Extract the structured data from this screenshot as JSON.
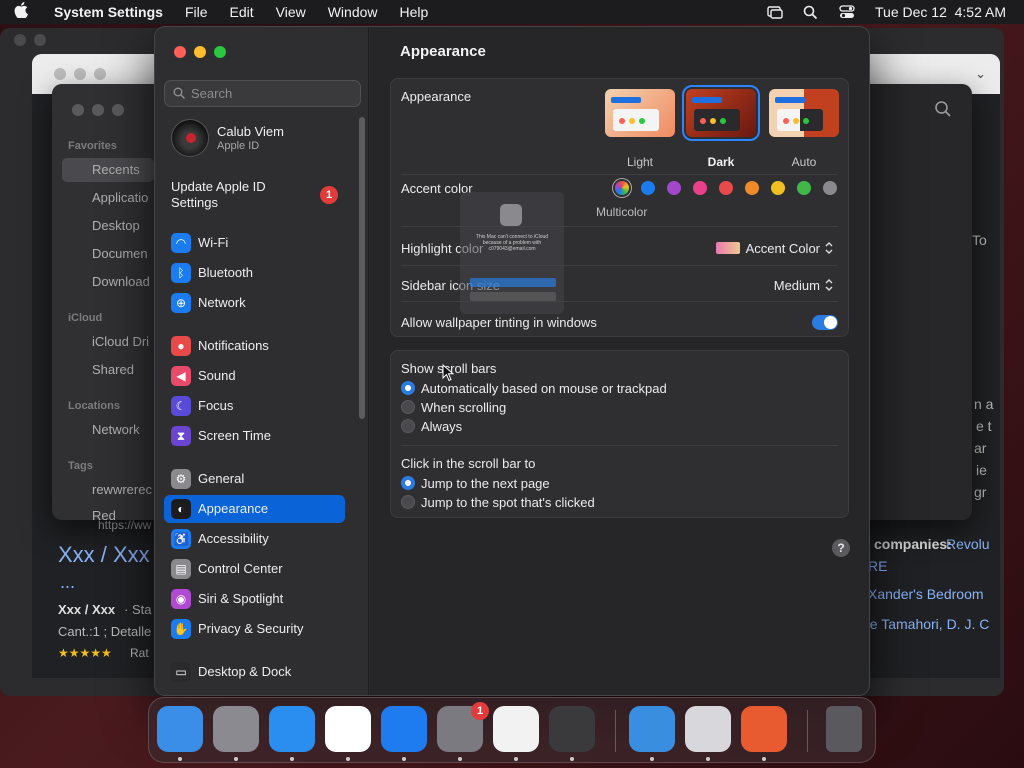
{
  "menubar": {
    "app_name": "System Settings",
    "menus": [
      "File",
      "Edit",
      "View",
      "Window",
      "Help"
    ],
    "datetime": "Tue Dec 12  4:52 AM"
  },
  "finder": {
    "favorites_label": "Favorites",
    "favorites": [
      "Recents",
      "Applicatio",
      "Desktop",
      "Documen",
      "Download"
    ],
    "icloud_label": "iCloud",
    "icloud": [
      "iCloud Dri",
      "Shared"
    ],
    "locations_label": "Locations",
    "locations": [
      "Network"
    ],
    "tags_label": "Tags",
    "tags": [
      "rewwrerec",
      "Red"
    ]
  },
  "browser": {
    "url_fragment": "https://ww",
    "result_title": "Xxx / Xxx",
    "ellipsis": "...",
    "snippet_bold": "Xxx / Xxx",
    "snippet_rest": " · Sta",
    "snippet_line2": "Cant.:1 ; Detalle",
    "rating_text": "Rat",
    "right_texts": [
      "To",
      "n a",
      "e t",
      "ar",
      "ie",
      "gr"
    ],
    "companies_label": "companies:",
    "companies_value": "Revolu",
    "companies_more": "RE",
    "xander": "Xander's Bedroom",
    "tamahori": "ee Tamahori, D. J. C"
  },
  "sidebar": {
    "search_placeholder": "Search",
    "user_name": "Calub Viem",
    "user_sub": "Apple ID",
    "update_label": "Update Apple ID Settings",
    "update_badge": "1",
    "items": [
      {
        "label": "Wi-Fi",
        "color": "#1a7cf0",
        "glyph": "◠"
      },
      {
        "label": "Bluetooth",
        "color": "#1a7cf0",
        "glyph": "ᛒ"
      },
      {
        "label": "Network",
        "color": "#1a7cf0",
        "glyph": "⊕"
      },
      {
        "label": "Notifications",
        "color": "#e84a4a",
        "glyph": "●"
      },
      {
        "label": "Sound",
        "color": "#e84a6a",
        "glyph": "◀"
      },
      {
        "label": "Focus",
        "color": "#5a4ad8",
        "glyph": "☾"
      },
      {
        "label": "Screen Time",
        "color": "#6a46d0",
        "glyph": "⧗"
      },
      {
        "label": "General",
        "color": "#8a8a8e",
        "glyph": "⚙"
      },
      {
        "label": "Appearance",
        "color": "#1c1c1e",
        "glyph": "◐"
      },
      {
        "label": "Accessibility",
        "color": "#1a7cf0",
        "glyph": "♿"
      },
      {
        "label": "Control Center",
        "color": "#8a8a8e",
        "glyph": "▤"
      },
      {
        "label": "Siri & Spotlight",
        "color": "#b04ad0",
        "glyph": "◉"
      },
      {
        "label": "Privacy & Security",
        "color": "#1a7cf0",
        "glyph": "✋"
      },
      {
        "label": "Desktop & Dock",
        "color": "#2a2a2c",
        "glyph": "▭"
      }
    ]
  },
  "main": {
    "title": "Appearance",
    "appearance_label": "Appearance",
    "modes": [
      "Light",
      "Dark",
      "Auto"
    ],
    "selected_mode": "Dark",
    "accent_label": "Accent color",
    "accent_colors": [
      "multicolor",
      "#1a7cf0",
      "#a048c8",
      "#e8408a",
      "#e84a4a",
      "#f08a28",
      "#f0c020",
      "#40b848",
      "#8a8a8e"
    ],
    "accent_selected_name": "Multicolor",
    "highlight_label": "Highlight color",
    "highlight_value": "Accent Color",
    "sidebar_icon_label": "Sidebar icon size",
    "sidebar_icon_value": "Medium",
    "tinting_label": "Allow wallpaper tinting in windows",
    "tinting_on": true,
    "scroll_label": "Show scroll bars",
    "scroll_options": [
      "Automatically based on mouse or trackpad",
      "When scrolling",
      "Always"
    ],
    "click_label": "Click in the scroll bar to",
    "click_options": [
      "Jump to the next page",
      "Jump to the spot that's clicked"
    ],
    "help": "?",
    "ghost_text": "This Mac can't connect to iCloud because of a problem with c079043@email.com"
  },
  "dock": {
    "apps": [
      {
        "name": "finder",
        "color": "#3a8ee8"
      },
      {
        "name": "launchpad",
        "color": "#8a8a90"
      },
      {
        "name": "safari",
        "color": "#2a8ef0"
      },
      {
        "name": "chrome",
        "color": "#ffffff"
      },
      {
        "name": "app-store",
        "color": "#1e7cf0"
      },
      {
        "name": "system-settings",
        "color": "#7a7a80",
        "badge": "1"
      },
      {
        "name": "textedit",
        "color": "#f2f2f2"
      },
      {
        "name": "garageband",
        "color": "#3a3a3c"
      },
      {
        "name": "weather",
        "color": "#3a8ee0"
      },
      {
        "name": "calculator",
        "color": "#d8d8dc"
      },
      {
        "name": "remote-desktop",
        "color": "#e85a30"
      },
      {
        "name": "trash",
        "color": "#5a5a5e"
      }
    ]
  }
}
